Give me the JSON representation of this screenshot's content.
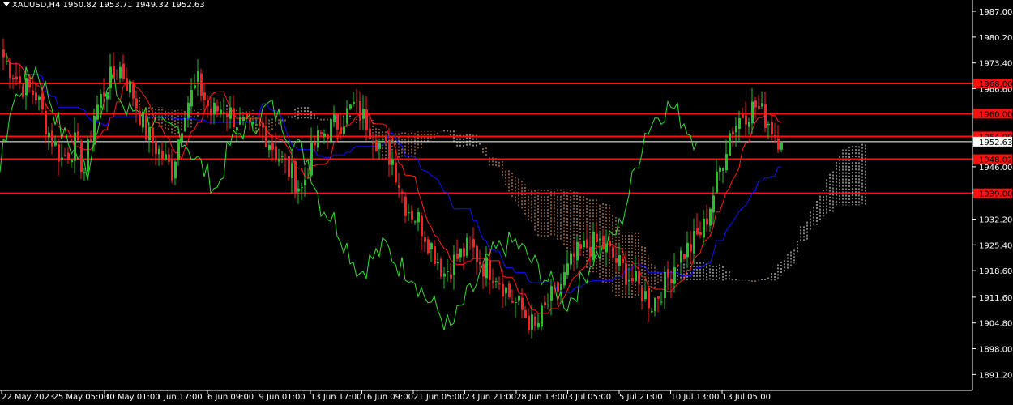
{
  "header": {
    "symbol_tf": "XAUUSD,H4",
    "ohlc": "1950.82 1953.71 1949.32 1952.63"
  },
  "colors": {
    "background": "#000000",
    "bull": "#22c422",
    "bear": "#ff1f1f",
    "tenkan": "#ff1a1a",
    "kijun": "#1010ff",
    "chikou": "#33dd33",
    "cloud_bull": "#ffffff",
    "cloud_bear": "#ffb070",
    "hline": "#ff1010",
    "axis_text": "#ffffff"
  },
  "chart_data": {
    "type": "candlestick",
    "indicator": "Ichimoku Kinko Hyo",
    "ylim": [
      1887.0,
      1990.0
    ],
    "y_ticks": [
      "1987.00",
      "1980.20",
      "1973.40",
      "1966.60",
      "1946.00",
      "1939.20",
      "1932.20",
      "1925.40",
      "1918.60",
      "1911.60",
      "1904.80",
      "1898.00",
      "1891.20"
    ],
    "x_ticks": [
      "22 May 2023",
      "25 May 05:00",
      "30 May 01:00",
      "1 Jun 17:00",
      "6 Jun 09:00",
      "9 Jun 01:00",
      "13 Jun 17:00",
      "16 Jun 09:00",
      "21 Jun 05:00",
      "23 Jun 21:00",
      "28 Jun 13:00",
      "3 Jul 05:00",
      "5 Jul 21:00",
      "10 Jul 13:00",
      "13 Jul 05:00"
    ],
    "horizontal_levels": [
      {
        "label": "1968.00",
        "value": 1968.0
      },
      {
        "label": "1960.00",
        "value": 1960.0
      },
      {
        "label": "1954.00",
        "value": 1954.0
      },
      {
        "label": "1948.02",
        "value": 1948.0
      },
      {
        "label": "1939.00",
        "value": 1939.0
      }
    ],
    "current_price": {
      "label": "1952.63",
      "value": 1952.63
    },
    "anchors": [
      {
        "bar": 0,
        "close": 1975
      },
      {
        "bar": 5,
        "close": 1968
      },
      {
        "bar": 10,
        "close": 1965
      },
      {
        "bar": 14,
        "close": 1955
      },
      {
        "bar": 18,
        "close": 1948
      },
      {
        "bar": 22,
        "close": 1952
      },
      {
        "bar": 25,
        "close": 1945
      },
      {
        "bar": 28,
        "close": 1960
      },
      {
        "bar": 32,
        "close": 1968
      },
      {
        "bar": 36,
        "close": 1972
      },
      {
        "bar": 40,
        "close": 1965
      },
      {
        "bar": 44,
        "close": 1955
      },
      {
        "bar": 48,
        "close": 1950
      },
      {
        "bar": 52,
        "close": 1945
      },
      {
        "bar": 56,
        "close": 1962
      },
      {
        "bar": 60,
        "close": 1968
      },
      {
        "bar": 64,
        "close": 1960
      },
      {
        "bar": 68,
        "close": 1962
      },
      {
        "bar": 72,
        "close": 1958
      },
      {
        "bar": 76,
        "close": 1955
      },
      {
        "bar": 80,
        "close": 1956
      },
      {
        "bar": 84,
        "close": 1950
      },
      {
        "bar": 88,
        "close": 1945
      },
      {
        "bar": 92,
        "close": 1940
      },
      {
        "bar": 96,
        "close": 1952
      },
      {
        "bar": 100,
        "close": 1956
      },
      {
        "bar": 104,
        "close": 1958
      },
      {
        "bar": 108,
        "close": 1962
      },
      {
        "bar": 112,
        "close": 1958
      },
      {
        "bar": 116,
        "close": 1952
      },
      {
        "bar": 120,
        "close": 1948
      },
      {
        "bar": 124,
        "close": 1936
      },
      {
        "bar": 128,
        "close": 1932
      },
      {
        "bar": 132,
        "close": 1925
      },
      {
        "bar": 136,
        "close": 1918
      },
      {
        "bar": 140,
        "close": 1922
      },
      {
        "bar": 144,
        "close": 1925
      },
      {
        "bar": 148,
        "close": 1920
      },
      {
        "bar": 152,
        "close": 1918
      },
      {
        "bar": 156,
        "close": 1912
      },
      {
        "bar": 160,
        "close": 1908
      },
      {
        "bar": 164,
        "close": 1903
      },
      {
        "bar": 168,
        "close": 1910
      },
      {
        "bar": 172,
        "close": 1915
      },
      {
        "bar": 176,
        "close": 1922
      },
      {
        "bar": 180,
        "close": 1925
      },
      {
        "bar": 184,
        "close": 1926
      },
      {
        "bar": 188,
        "close": 1922
      },
      {
        "bar": 192,
        "close": 1918
      },
      {
        "bar": 196,
        "close": 1914
      },
      {
        "bar": 200,
        "close": 1910
      },
      {
        "bar": 204,
        "close": 1915
      },
      {
        "bar": 208,
        "close": 1922
      },
      {
        "bar": 212,
        "close": 1925
      },
      {
        "bar": 216,
        "close": 1930
      },
      {
        "bar": 220,
        "close": 1942
      },
      {
        "bar": 224,
        "close": 1955
      },
      {
        "bar": 228,
        "close": 1960
      },
      {
        "bar": 232,
        "close": 1962
      },
      {
        "bar": 236,
        "close": 1958
      },
      {
        "bar": 238,
        "close": 1955
      },
      {
        "bar": 240,
        "close": 1952.63
      }
    ]
  }
}
